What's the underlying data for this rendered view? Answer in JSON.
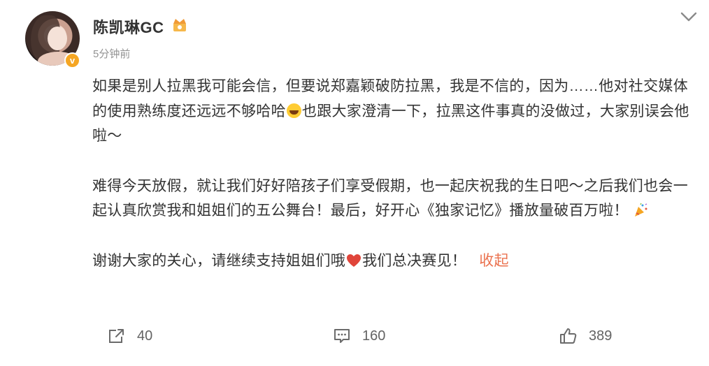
{
  "post": {
    "author": "陈凯琳GC",
    "time": "5分钟前",
    "paragraph1": "如果是别人拉黑我可能会信，但要说郑嘉颖破防拉黑，我是不信的，因为……他对社交媒体的使用熟练度还远远不够哈哈",
    "paragraph1b": "也跟大家澄清一下，拉黑这件事真的没做过，大家别误会他啦～",
    "paragraph2": "难得今天放假，就让我们好好陪孩子们享受假期，也一起庆祝我的生日吧～之后我们也会一起认真欣赏我和姐姐们的五公舞台！最后，好开心《独家记忆》播放量破百万啦！",
    "paragraph3a": "谢谢大家的关心，请继续支持姐姐们哦",
    "paragraph3b": "我们总决赛见！",
    "collapse_label": "收起"
  },
  "actions": {
    "repost_count": "40",
    "comment_count": "160",
    "like_count": "389"
  },
  "colors": {
    "text": "#333333",
    "muted": "#939393",
    "link": "#eb7350",
    "verified": "#f5a623"
  },
  "icons": [
    "avatar",
    "verified-badge-icon",
    "crown-icon",
    "chevron-down-icon",
    "laughing-emoji-icon",
    "party-popper-icon",
    "heart-icon",
    "repost-icon",
    "comment-icon",
    "like-icon"
  ]
}
